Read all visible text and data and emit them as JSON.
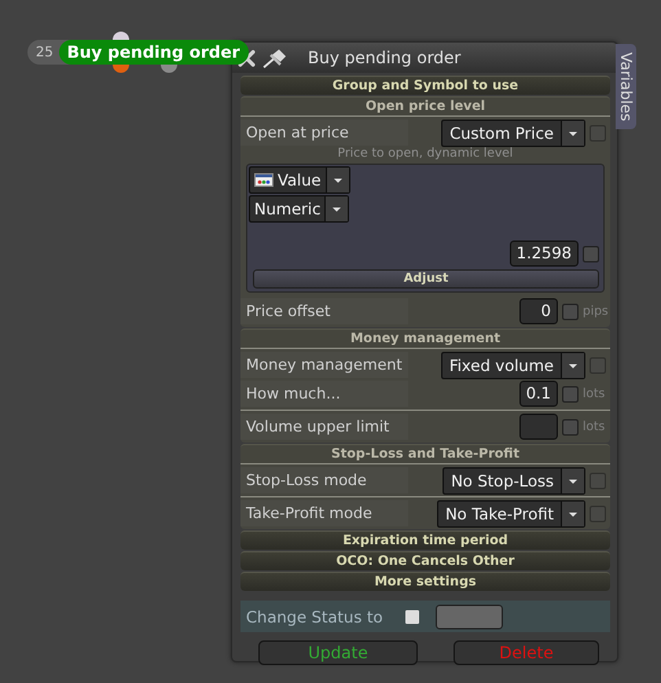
{
  "node": {
    "number": "25",
    "label": "Buy pending order"
  },
  "window": {
    "title": "Buy pending order",
    "side_tab": "Variables"
  },
  "sections": [
    {
      "title": "Group and Symbol to use",
      "expanded": false
    },
    {
      "title": "Open price level",
      "expanded": true,
      "groups": [
        [
          {
            "kind": "select",
            "label": "Open at price",
            "value": "Custom Price",
            "checked": false
          },
          {
            "kind": "caption",
            "text": "Price to open, dynamic level"
          },
          {
            "kind": "value_box",
            "source": "Value",
            "type": "Numeric",
            "value": "1.2598",
            "checked": false,
            "button": "Adjust"
          },
          {
            "kind": "number",
            "label": "Price offset",
            "value": "0",
            "checked": false,
            "unit": "pips"
          }
        ]
      ]
    },
    {
      "title": "Money management",
      "expanded": true,
      "groups": [
        [
          {
            "kind": "select",
            "label": "Money management",
            "value": "Fixed volume",
            "checked": false
          },
          {
            "kind": "number",
            "label": "How much...",
            "value": "0.1",
            "checked": false,
            "unit": "lots"
          }
        ],
        [
          {
            "kind": "number",
            "label": "Volume upper limit",
            "checked": false,
            "unit": "lots"
          }
        ]
      ]
    },
    {
      "title": "Stop-Loss and Take-Profit",
      "expanded": true,
      "groups": [
        [
          {
            "kind": "select",
            "label": "Stop-Loss mode",
            "value": "No Stop-Loss",
            "checked": false
          }
        ],
        [
          {
            "kind": "select",
            "label": "Take-Profit mode",
            "value": "No Take-Profit",
            "checked": false
          }
        ]
      ]
    },
    {
      "title": "Expiration time period",
      "expanded": false
    },
    {
      "title": "OCO: One Cancels Other",
      "expanded": false
    },
    {
      "title": "More settings",
      "expanded": false
    }
  ],
  "status": {
    "label": "Change Status to",
    "checked": false
  },
  "buttons": [
    {
      "label": "Update",
      "kind": "update"
    },
    {
      "label": "Delete",
      "kind": "delete"
    }
  ]
}
